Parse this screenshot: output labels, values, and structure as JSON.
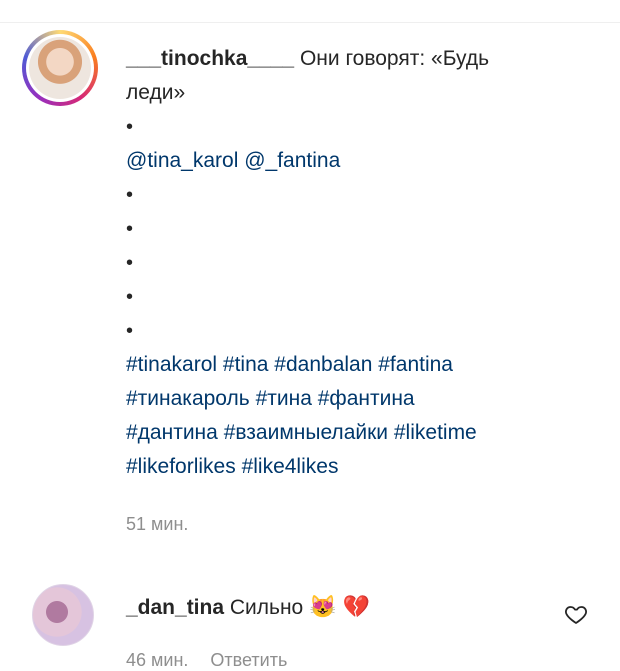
{
  "post": {
    "username": "___tinochka____",
    "text_start": " Они говорят: «Будь",
    "text_cont": "леди»",
    "dot": "•",
    "mentions": [
      "@tina_karol",
      "@_fantina"
    ],
    "hashtag_lines": [
      [
        "#tinakarol",
        "#tina",
        "#danbalan",
        "#fantina"
      ],
      [
        "#тинакароль",
        "#тина",
        "#фантина"
      ],
      [
        "#дантина",
        "#взаимныелайки",
        "#liketime"
      ],
      [
        "#likeforlikes",
        "#like4likes"
      ]
    ],
    "timestamp": "51 мин."
  },
  "reply": {
    "username": "_dan_tina",
    "text": " Сильно",
    "emoji_cat": "😻",
    "emoji_heart": "💔",
    "like_icon": "heart-outline-icon",
    "timestamp": "46 мин.",
    "reply_label": "Ответить"
  }
}
